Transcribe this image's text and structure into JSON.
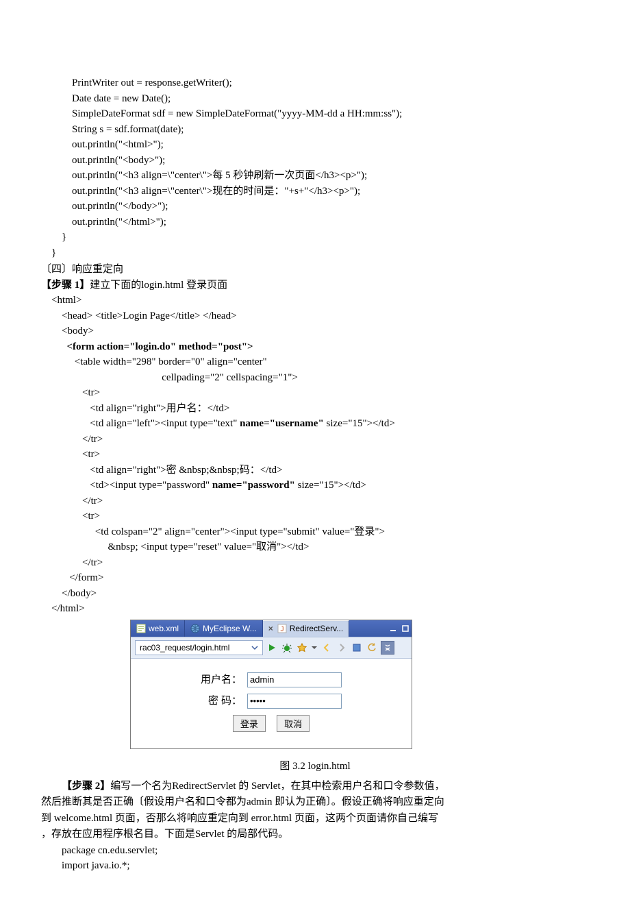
{
  "code_block_a": [
    "            PrintWriter out = response.getWriter();",
    "            Date date = new Date();",
    "            SimpleDateFormat sdf = new SimpleDateFormat(\"yyyy-MM-dd a HH:mm:ss\");",
    "            String s = sdf.format(date);",
    "",
    "            out.println(\"<html>\");",
    "            out.println(\"<body>\");",
    "            out.println(\"<h3 align=\\\"center\\\">每 5 秒钟刷新一次页面</h3><p>\");",
    "            out.println(\"<h3 align=\\\"center\\\">现在的时间是：\"+s+\"</h3><p>\");",
    "",
    "            out.println(\"</body>\");",
    "            out.println(\"</html>\");",
    "        }",
    "    }"
  ],
  "section_four": "〔四〕响应重定向",
  "step1_prefix": "【步骤 1】",
  "step1_rest": "建立下面的login.html 登录页面",
  "code_block_b": [
    "    <html>",
    "        <head> <title>Login Page</title> </head>",
    "        <body>"
  ],
  "code_block_b_form_open": "          <form action=\"login.do\" method=\"post\">",
  "code_block_b2": [
    "             <table width=\"298\" border=\"0\" align=\"center\"",
    "                                               cellpading=\"2\" cellspacing=\"1\">",
    "                <tr>",
    "                   <td align=\"right\">用户名：</td>"
  ],
  "code_block_b_username_pre": "                   <td align=\"left\"><input type=\"text\" ",
  "code_block_b_username_bold": "name=\"username\"",
  "code_block_b_username_post": " size=\"15\"></td>",
  "code_block_b3": [
    "                </tr>",
    "                <tr>",
    "                   <td align=\"right\">密 &nbsp;&nbsp;码：</td>"
  ],
  "code_block_b_password_pre": "                   <td><input type=\"password\" ",
  "code_block_b_password_bold": "name=\"password\"",
  "code_block_b_password_post": " size=\"15\"></td>",
  "code_block_b4": [
    "                </tr>",
    "                <tr>",
    "                     <td colspan=\"2\" align=\"center\"><input type=\"submit\" value=\"登录\">",
    "                          &nbsp; <input type=\"reset\" value=\"取消\"></td>",
    "                </tr>",
    "           </form>",
    "        </body>",
    "    </html>"
  ],
  "tabs": {
    "webxml": "web.xml",
    "myeclipse": "MyEclipse W...",
    "redirect": "RedirectServ..."
  },
  "addr_value": "rac03_request/login.html",
  "form": {
    "user_label": "用户名：",
    "user_value": "admin",
    "pass_label": "密   码：",
    "pass_value": "•••••",
    "submit": "登录",
    "reset": "取消"
  },
  "figure_caption": "图 3.2 login.html",
  "step2_prefix": "【步骤 2】",
  "step2_rest": "编写一个名为RedirectServlet 的 Servlet，在其中检索用户名和口令参数值，",
  "para2": "然后推断其是否正确〔假设用户名和口令都为admin 即认为正确〕。假设正确将响应重定向",
  "para3": "到 welcome.html 页面，否那么将响应重定向到 error.html 页面，这两个页面请你自己编写",
  "para4": "，存放在应用程序根名目。下面是Servlet 的局部代码。",
  "code_block_c": [
    "        package cn.edu.servlet;",
    "        import java.io.*;"
  ]
}
